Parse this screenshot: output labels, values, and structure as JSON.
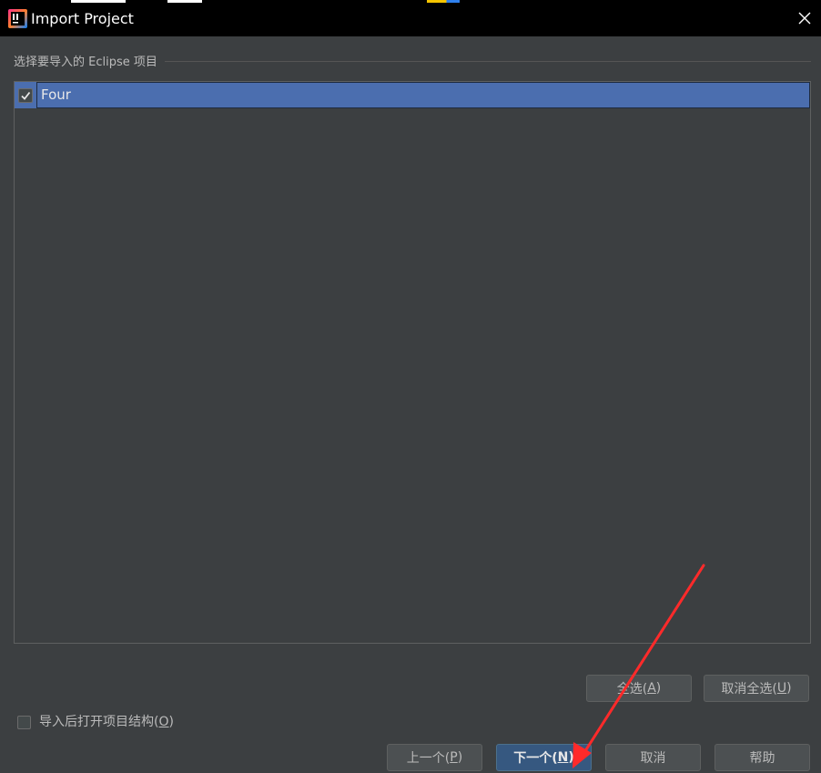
{
  "window": {
    "title": "Import Project",
    "close_symbol": "✕"
  },
  "section": {
    "label": "选择要导入的 Eclipse 项目"
  },
  "projects": [
    {
      "name": "Four",
      "checked": true
    }
  ],
  "buttons": {
    "select_all": {
      "prefix": "全选(",
      "mnemonic": "A",
      "suffix": ")"
    },
    "deselect_all": {
      "prefix": "取消全选(",
      "mnemonic": "U",
      "suffix": ")"
    },
    "previous": {
      "prefix": "上一个(",
      "mnemonic": "P",
      "suffix": ")"
    },
    "next": {
      "prefix": "下一个(",
      "mnemonic": "N",
      "suffix": ")"
    },
    "cancel": "取消",
    "help": "帮助"
  },
  "open_structure_option": {
    "prefix": "导入后打开项目结构(",
    "mnemonic": "O",
    "suffix": ")",
    "checked": false
  },
  "colors": {
    "background": "#3c3f41",
    "title_bar": "#000000",
    "selection": "#4b6eaf",
    "primary_button": "#365880",
    "annotation_arrow": "#ff2a2a"
  },
  "icons": {
    "app": "intellij-idea-icon",
    "close": "close-icon",
    "check": "checkmark-icon"
  }
}
